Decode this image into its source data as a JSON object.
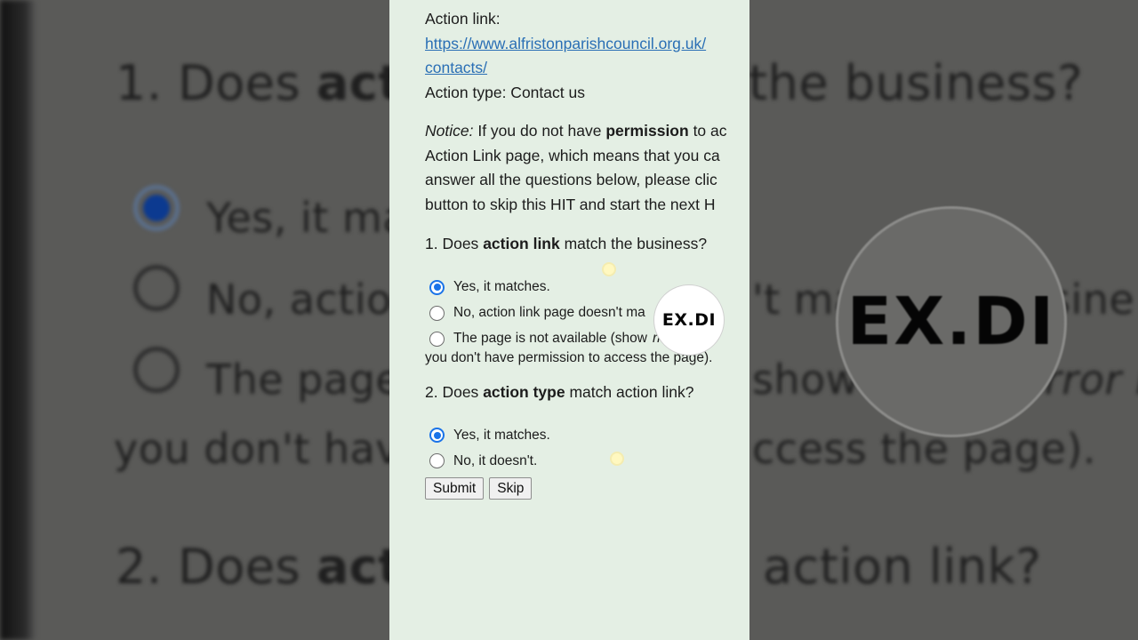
{
  "background": {
    "q1_prefix": "1. Does ",
    "q1_bold": "act",
    "q1_suffix": "the business?",
    "opt_yes": "Yes, it ma",
    "opt_no": "No, actio",
    "opt_no_right": "'t ma",
    "opt_no_right2": "sine",
    "opt_page": "The page",
    "opt_page_right": "show",
    "opt_page_right2": "rror r",
    "opt_page_line2_left": "you don't have",
    "opt_page_line2_right": "ccess the page).",
    "q2_prefix": "2. Does ",
    "q2_bold": "act",
    "q2_suffix": "action link?"
  },
  "watermark": {
    "text": "EX.DI"
  },
  "form": {
    "action_link_label": "Action link:",
    "action_link_url_line1": "https://www.alfristonparishcouncil.org.uk/",
    "action_link_url_line2": "contacts/",
    "action_type_line": "Action type: Contact us",
    "notice": {
      "label": "Notice:",
      "text_before_bold": " If you do not have ",
      "bold": "permission",
      "text_after_bold": " to ac",
      "line2": "Action Link page, which means that you ca",
      "line3": "answer all the questions below, please clic",
      "line4": "button to skip this HIT and start the next H"
    },
    "q1": {
      "prefix": "1. Does ",
      "bold": "action link",
      "suffix": " match the business?",
      "options": [
        {
          "label": "Yes, it matches.",
          "selected": true
        },
        {
          "label": "No, action link page doesn't ma",
          "selected": false
        },
        {
          "label": "The page is not available (show",
          "selected": false
        }
      ],
      "option3_tail": "rror r",
      "option3_line2": "you don't have permission to access the page)."
    },
    "q2": {
      "prefix": "2. Does ",
      "bold": "action type",
      "suffix": " match action link?",
      "options": [
        {
          "label": "Yes, it matches.",
          "selected": true
        },
        {
          "label": "No, it doesn't.",
          "selected": false
        }
      ]
    },
    "submit_label": "Submit",
    "skip_label": "Skip"
  },
  "colors": {
    "link": "#2a6fb5",
    "radio_selected": "#1a73e8",
    "panel_bg": "#e4efe4"
  }
}
